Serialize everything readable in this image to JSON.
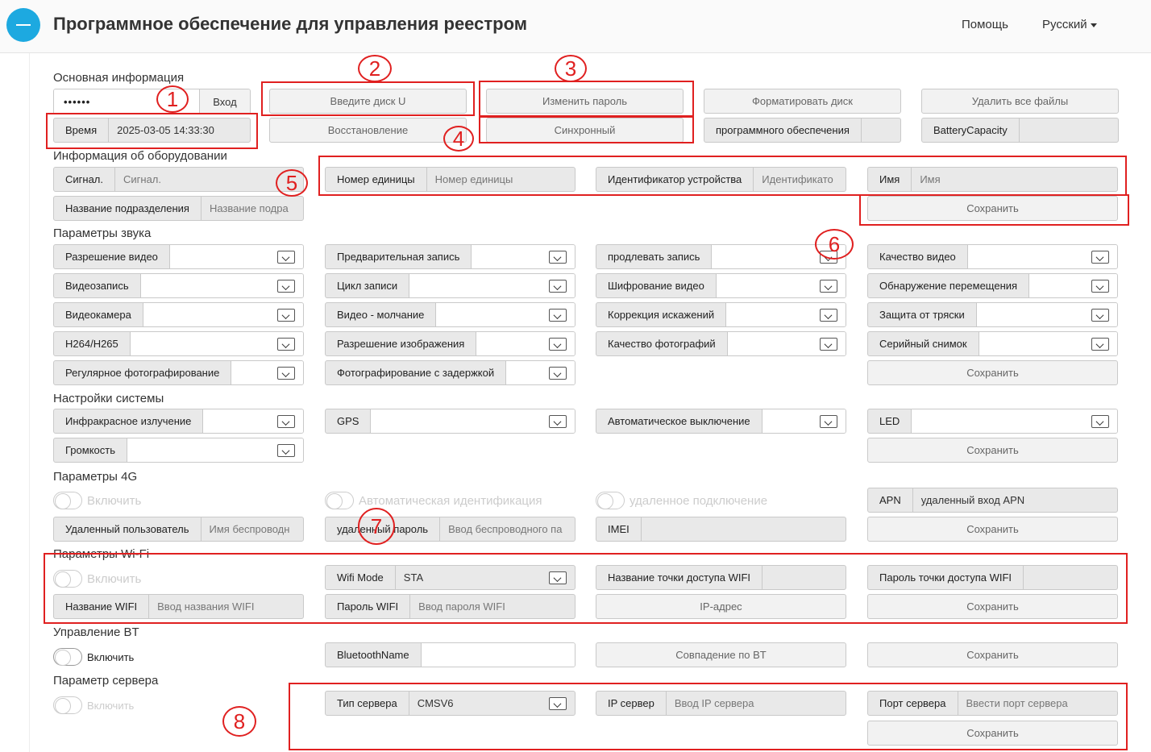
{
  "header": {
    "title": "Программное обеспечение для управления реестром",
    "help": "Помощь",
    "language": "Русский"
  },
  "basic": {
    "title": "Основная информация",
    "password": "••••••",
    "login": "Вход",
    "enter_disk": "Введите диск U",
    "change_password": "Изменить пароль",
    "format_disk": "Форматировать диск",
    "delete_all": "Удалить все файлы",
    "time_label": "Время",
    "time_value": "2025-03-05 14:33:30",
    "restore": "Восстановление",
    "sync": "Синхронный",
    "software_label": "программного обеспечения",
    "battery_label": "BatteryCapacity"
  },
  "equipment": {
    "title": "Информация об оборудовании",
    "signal_label": "Сигнал.",
    "signal_ph": "Сигнал.",
    "unit_label": "Номер единицы",
    "unit_ph": "Номер единицы",
    "device_label": "Идентификатор устройства",
    "device_ph": "Идентификато",
    "name_label": "Имя",
    "name_ph": "Имя",
    "division_label": "Название подразделения",
    "division_ph": "Название подра",
    "save": "Сохранить"
  },
  "audio": {
    "title": "Параметры звука",
    "video_res": "Разрешение видео",
    "pre_rec": "Предварительная запись",
    "extend_rec": "продлевать запись",
    "video_quality": "Качество видео",
    "video_rec": "Видеозапись",
    "rec_cycle": "Цикл записи",
    "video_enc": "Шифрование видео",
    "motion": "Обнаружение перемещения",
    "camera": "Видеокамера",
    "video_silent": "Видео - молчание",
    "distortion": "Коррекция искажений",
    "shake": "Защита от тряски",
    "codec": "H264/H265",
    "img_res": "Разрешение изображения",
    "photo_quality": "Качество фотографий",
    "burst": "Серийный снимок",
    "regular_photo": "Регулярное фотографирование",
    "delay_photo": "Фотографирование с задержкой",
    "save": "Сохранить"
  },
  "system": {
    "title": "Настройки системы",
    "ir": "Инфракрасное излучение",
    "gps": "GPS",
    "auto_off": "Автоматическое выключение",
    "led": "LED",
    "volume": "Громкость",
    "save": "Сохранить"
  },
  "g4": {
    "title": "Параметры 4G",
    "enable": "Включить",
    "auto_id": "Автоматическая идентификация",
    "remote": "удаленное подключение",
    "apn_label": "APN",
    "apn_ph": "удаленный вход APN",
    "remote_user": "Удаленный пользователь",
    "remote_user_ph": "Имя беспроводн",
    "remote_pwd": "удаленный пароль",
    "remote_pwd_ph": "Ввод беспроводного па",
    "imei": "IMEI",
    "save": "Сохранить"
  },
  "wifi": {
    "title": "Параметры Wi-Fi",
    "enable": "Включить",
    "mode_label": "Wifi Mode",
    "mode_value": "STA",
    "ap_name": "Название точки доступа WIFI",
    "ap_pwd": "Пароль точки доступа WIFI",
    "wifi_name": "Название WIFI",
    "wifi_name_ph": "Ввод названия WIFI",
    "wifi_pwd": "Пароль WIFI",
    "wifi_pwd_ph": "Ввод пароля WIFI",
    "ip": "IP-адрес",
    "save": "Сохранить"
  },
  "bt": {
    "title": "Управление BT",
    "enable": "Включить",
    "name_label": "BluetoothName",
    "match": "Совпадение по BT",
    "save": "Сохранить"
  },
  "server": {
    "title": "Параметр сервера",
    "enable": "Включить",
    "type_label": "Тип сервера",
    "type_value": "CMSV6",
    "ip_label": "IP сервер",
    "ip_ph": "Ввод IP сервера",
    "port_label": "Порт сервера",
    "port_ph": "Ввести порт сервера",
    "save": "Сохранить"
  },
  "callouts": [
    "1",
    "2",
    "3",
    "4",
    "5",
    "6",
    "7",
    "8"
  ],
  "colors": {
    "accent": "#1da9e0",
    "annotation": "#e02020"
  }
}
